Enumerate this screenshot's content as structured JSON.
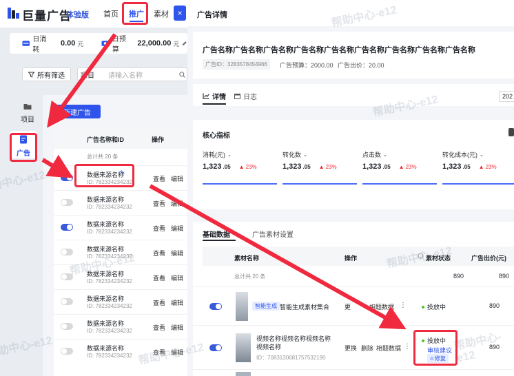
{
  "brand": {
    "name": "巨量广告",
    "tag": "体验版"
  },
  "nav": {
    "home": "首页",
    "promote": "推广",
    "material": "素材",
    "close_glyph": "×"
  },
  "stats": {
    "daily_cost_label": "日消耗",
    "daily_cost_value": "0.00",
    "daily_cost_unit": "元",
    "budget_label": "日预算",
    "budget_value": "22,000.00",
    "budget_unit": "元"
  },
  "filter": {
    "all_filter": "所有筛选",
    "project_label": "项目",
    "search_placeholder": "请输入名称"
  },
  "sidebar": {
    "project": "项目",
    "ad": "广告"
  },
  "left_list": {
    "new_button": "新建广告",
    "col_name": "广告名称和ID",
    "col_ops": "操作",
    "total": "总计共 20 条",
    "view": "查看",
    "edit": "编辑",
    "rows": [
      {
        "name": "数据来源名称",
        "id": "ID: 782334234232",
        "on": true
      },
      {
        "name": "数据来源名称",
        "id": "ID: 782334234232",
        "on": false
      },
      {
        "name": "数据来源名称",
        "id": "ID: 782334234232",
        "on": true
      },
      {
        "name": "数据来源名称",
        "id": "ID: 782334234232",
        "on": false
      },
      {
        "name": "数据来源名称",
        "id": "ID: 782334234232",
        "on": false
      },
      {
        "name": "数据来源名称",
        "id": "ID: 782334234232",
        "on": false
      },
      {
        "name": "数据来源名称",
        "id": "ID: 782334234232",
        "on": false
      },
      {
        "name": "数据来源名称",
        "id": "ID: 782334234232",
        "on": false
      }
    ]
  },
  "detail": {
    "header": "广告详情",
    "title": "广告名称广告名称广告名称广告名称广告名称广告名称广告名称广告名称广告名称",
    "ad_id": "广告ID：3283578454966",
    "budget": "广告预算：2000.00",
    "bid": "广告出价：20.00",
    "tab_detail": "详情",
    "tab_log": "日志",
    "date_stub": "202",
    "core_metrics": "核心指标",
    "metrics": [
      {
        "name": "消耗(元)",
        "value": "1,323",
        "dec": ".05",
        "delta": "23%"
      },
      {
        "name": "转化数",
        "value": "1,323",
        "dec": ".05",
        "delta": "23%"
      },
      {
        "name": "点击数",
        "value": "1,323",
        "dec": ".05",
        "delta": "23%"
      },
      {
        "name": "转化成本(元)",
        "value": "1,323",
        "dec": ".05",
        "delta": "23%"
      }
    ],
    "tab_basic": "基础数据",
    "tab_material_settings": "广告素材设置",
    "table": {
      "col_material": "素材名称",
      "col_ops": "操作",
      "col_status": "素材状态",
      "col_bid": "广告出价(元)",
      "total": "总计共 20 条",
      "total_v1": "890",
      "total_v2": "890",
      "r1_tag": "智能生成",
      "r1_name": "智能生成素材集合",
      "r1_ops_a": "更",
      "r1_ops_b": "相题数据",
      "r1_status": "投放中",
      "r1_bid": "890",
      "r2_name": "视频名称视频名称视频名称视频名称",
      "r2_id": "ID：7083130681757532190",
      "r2_op_change": "更换",
      "r2_op_delete": "删除",
      "r2_op_data": "相题数据",
      "r2_status": "投放中",
      "r2_review": "审核建议",
      "r2_fix": "修复",
      "r2_bid": "890"
    }
  },
  "watermark": "帮助中心-e12",
  "colors": {
    "accent": "#2f54eb",
    "annotation_red": "#f0293e",
    "up_red": "#f5222d",
    "running_green": "#52c41a"
  }
}
